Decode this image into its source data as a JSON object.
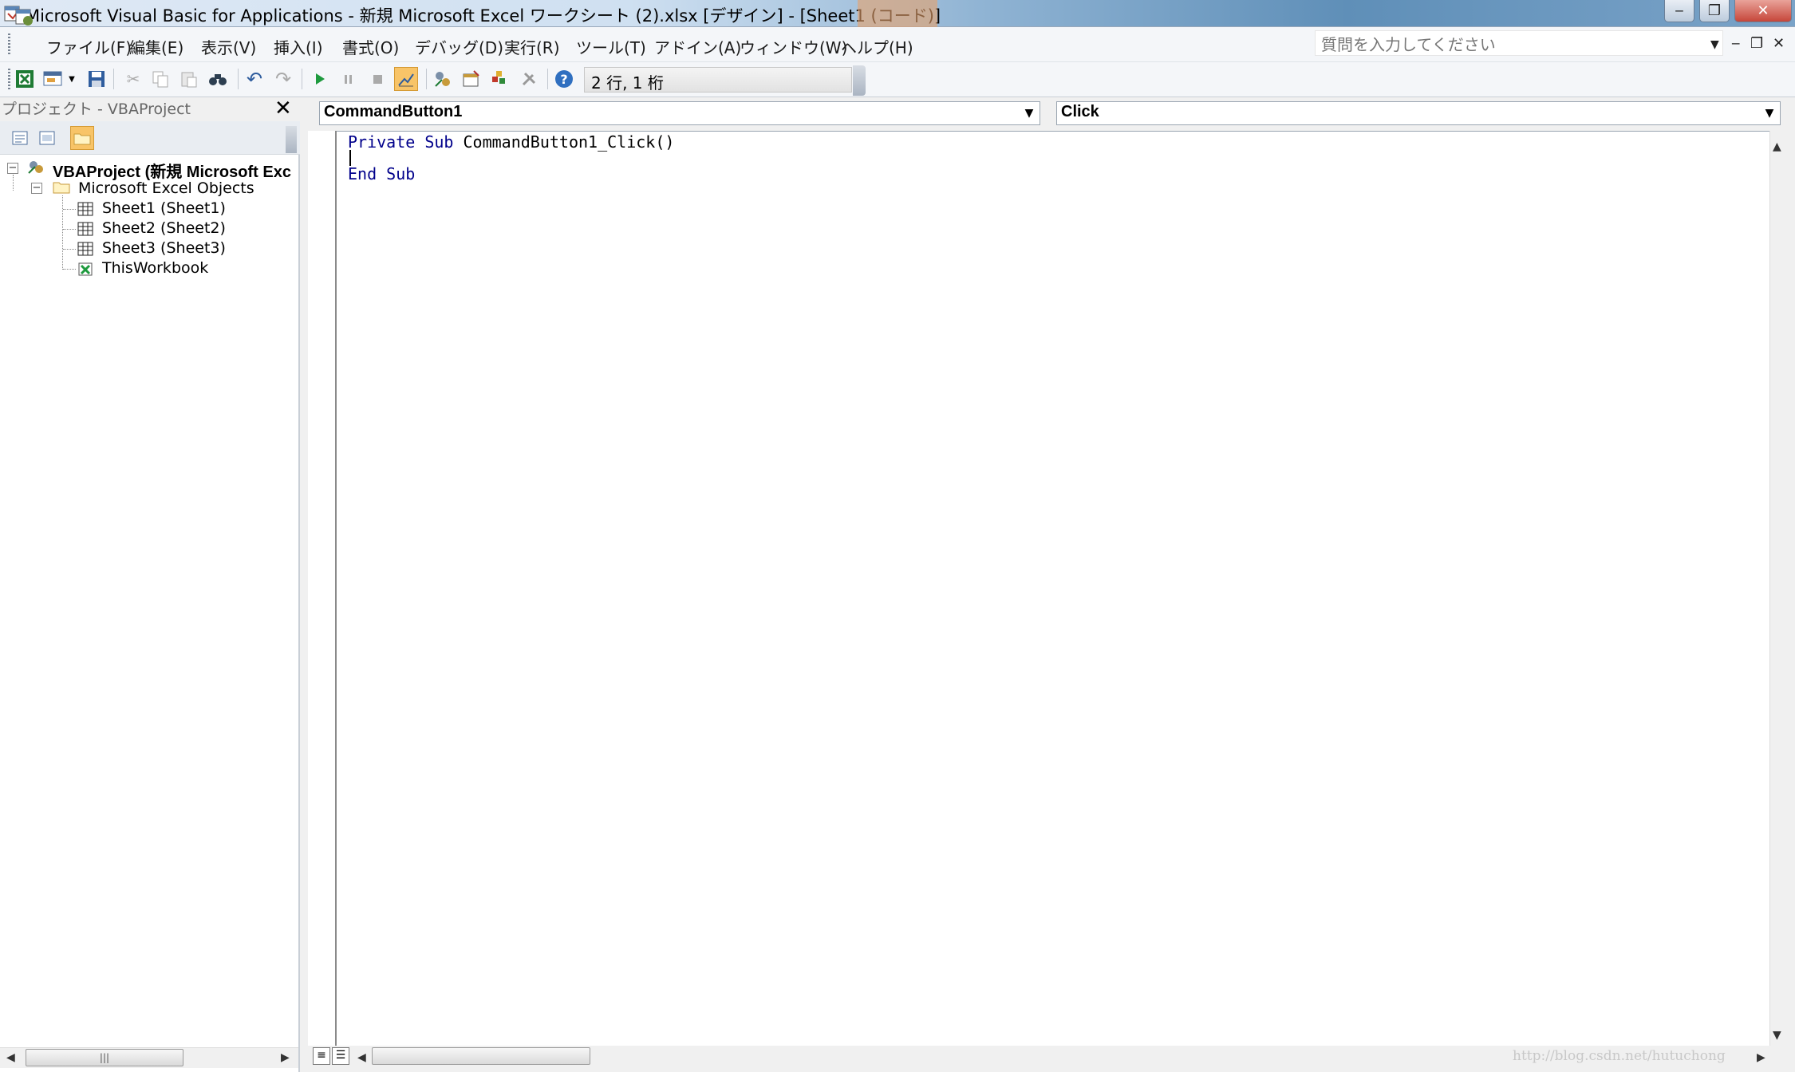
{
  "window": {
    "title": "Microsoft Visual Basic for Applications - 新規 Microsoft Excel ワークシート (2).xlsx [デザイン] - [Sheet1 (コード)]",
    "minimize": "‒",
    "restore": "❐",
    "close": "✕"
  },
  "menu": {
    "items": [
      "ファイル(F)",
      "編集(E)",
      "表示(V)",
      "挿入(I)",
      "書式(O)",
      "デバッグ(D)",
      "実行(R)",
      "ツール(T)",
      "アドイン(A)",
      "ウィンドウ(W)",
      "ヘルプ(H)"
    ],
    "help_placeholder": "質問を入力してください",
    "doc_minimize": "‒",
    "doc_restore": "❐",
    "doc_close": "✕"
  },
  "toolbar": {
    "position": "2 行, 1 桁",
    "icons": [
      "excel-view-icon",
      "insert-userform-icon",
      "save-icon",
      "cut-icon",
      "copy-icon",
      "paste-icon",
      "find-icon",
      "undo-icon",
      "redo-icon",
      "run-icon",
      "break-icon",
      "reset-icon",
      "design-mode-icon",
      "project-explorer-icon",
      "properties-icon",
      "object-browser-icon",
      "toolbox-icon",
      "help-icon"
    ]
  },
  "project": {
    "title": "プロジェクト - VBAProject",
    "close": "✕",
    "tree": {
      "root": "VBAProject (新規 Microsoft Exc",
      "folder": "Microsoft Excel Objects",
      "items": [
        "Sheet1 (Sheet1)",
        "Sheet2 (Sheet2)",
        "Sheet3 (Sheet3)",
        "ThisWorkbook"
      ]
    }
  },
  "code": {
    "object": "CommandButton1",
    "procedure": "Click",
    "line1_kw": "Private Sub",
    "line1_rest": " CommandButton1_Click()",
    "line3": "End Sub"
  },
  "watermark": "http://blog.csdn.net/hutuchong",
  "colors": {
    "keyword": "#00008b",
    "active_button": "#f8c468"
  }
}
